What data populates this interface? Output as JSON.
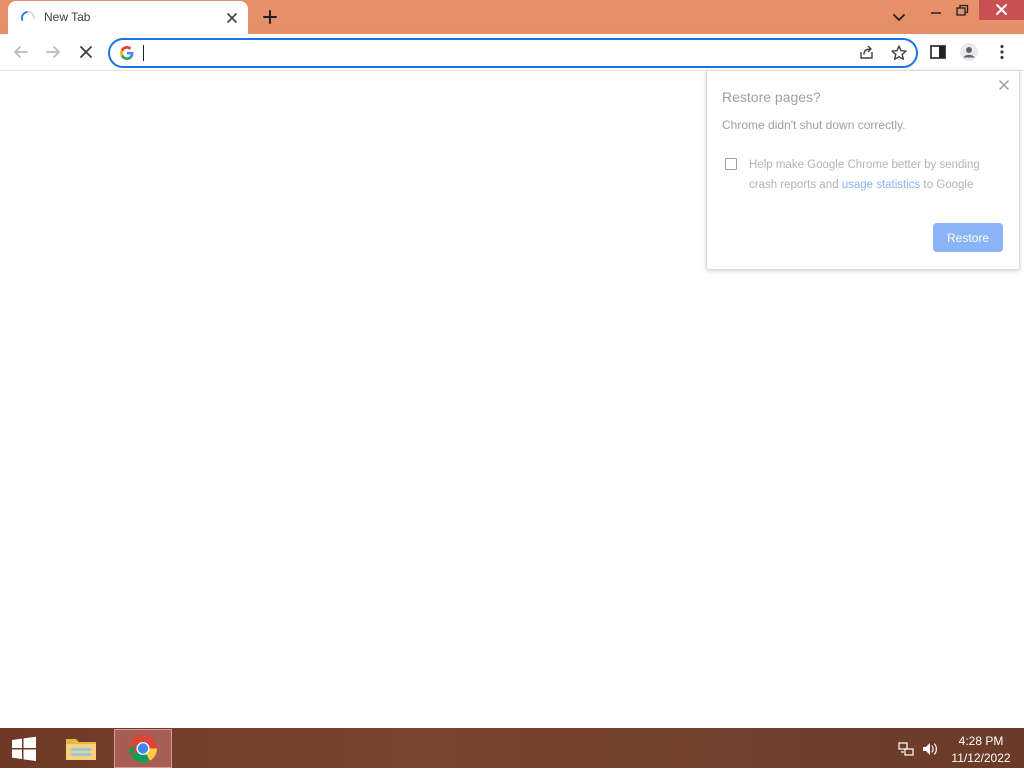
{
  "colors": {
    "titlebar": "#e8906a",
    "accent": "#1a73e8",
    "restore_button": "#8ab4f8",
    "close_button": "#c75050",
    "taskbar": "#6e3a25"
  },
  "tab": {
    "title": "New Tab",
    "loading": true
  },
  "omnibox": {
    "value": "",
    "placeholder": ""
  },
  "restore_dialog": {
    "title": "Restore pages?",
    "body": "Chrome didn't shut down correctly.",
    "help_prefix": "Help make Google Chrome better by sending crash reports and ",
    "help_link": "usage statistics",
    "help_suffix": " to Google",
    "checkbox_checked": false,
    "restore_label": "Restore"
  },
  "taskbar": {
    "apps": [
      "file-explorer-icon",
      "chrome-icon"
    ],
    "time": "4:28 PM",
    "date": "11/12/2022"
  }
}
